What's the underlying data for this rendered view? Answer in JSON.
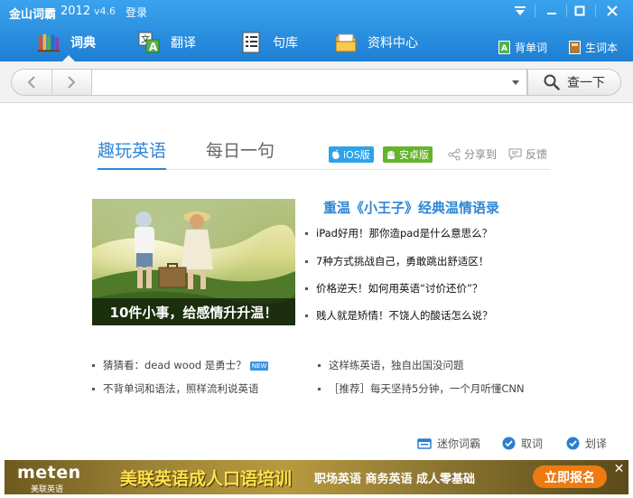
{
  "titlebar": {
    "app_name": "金山词霸",
    "year": "2012",
    "version": "v4.6",
    "login": "登录",
    "accent": "#2a8ee0"
  },
  "nav": {
    "tabs": [
      {
        "label": "词典",
        "icon": "books-icon",
        "active": true
      },
      {
        "label": "翻译",
        "icon": "translate-icon",
        "active": false
      },
      {
        "label": "句库",
        "icon": "document-icon",
        "active": false
      },
      {
        "label": "资料中心",
        "icon": "folder-icon",
        "active": false
      }
    ],
    "right_tabs": [
      {
        "label": "背单词",
        "icon": "word-card-icon"
      },
      {
        "label": "生词本",
        "icon": "notebook-icon"
      }
    ]
  },
  "search": {
    "value": "",
    "button_label": "查一下"
  },
  "content": {
    "tabs": [
      {
        "label": "趣玩英语",
        "active": true
      },
      {
        "label": "每日一句",
        "active": false
      }
    ],
    "ios_badge": "iOS版",
    "android_badge": "安卓版",
    "share": "分享到",
    "feedback": "反馈",
    "photo_caption": "10件小事，给感情升升温！",
    "headline": "重温《小王子》经典温情语录",
    "news": [
      "iPad好用！那你造pad是什么意思么？",
      "7种方式挑战自己，勇敢跳出舒适区！",
      "价格逆天！如何用英语“讨价还价”？",
      "贱人就是矫情！不饶人的酸话怎么说？"
    ],
    "bottom_links": [
      {
        "text": "猜猜看：dead wood 是勇士？",
        "tag": "NEW"
      },
      {
        "text": "这样练英语，独自出国没问题"
      },
      {
        "text": "不背单词和语法，照样流利说英语"
      },
      {
        "text": "［推荐］每天坚持5分钟，一个月听懂CNN"
      }
    ]
  },
  "footer": {
    "mini": "迷你词霸",
    "pick": "取词",
    "select": "划译"
  },
  "ad": {
    "brand": "meten",
    "brand_sub": "美联英语",
    "main": "美联英语成人口语培训",
    "sub": "职场英语  商务英语  成人零基础",
    "cta": "立即报名",
    "close": "✕"
  }
}
